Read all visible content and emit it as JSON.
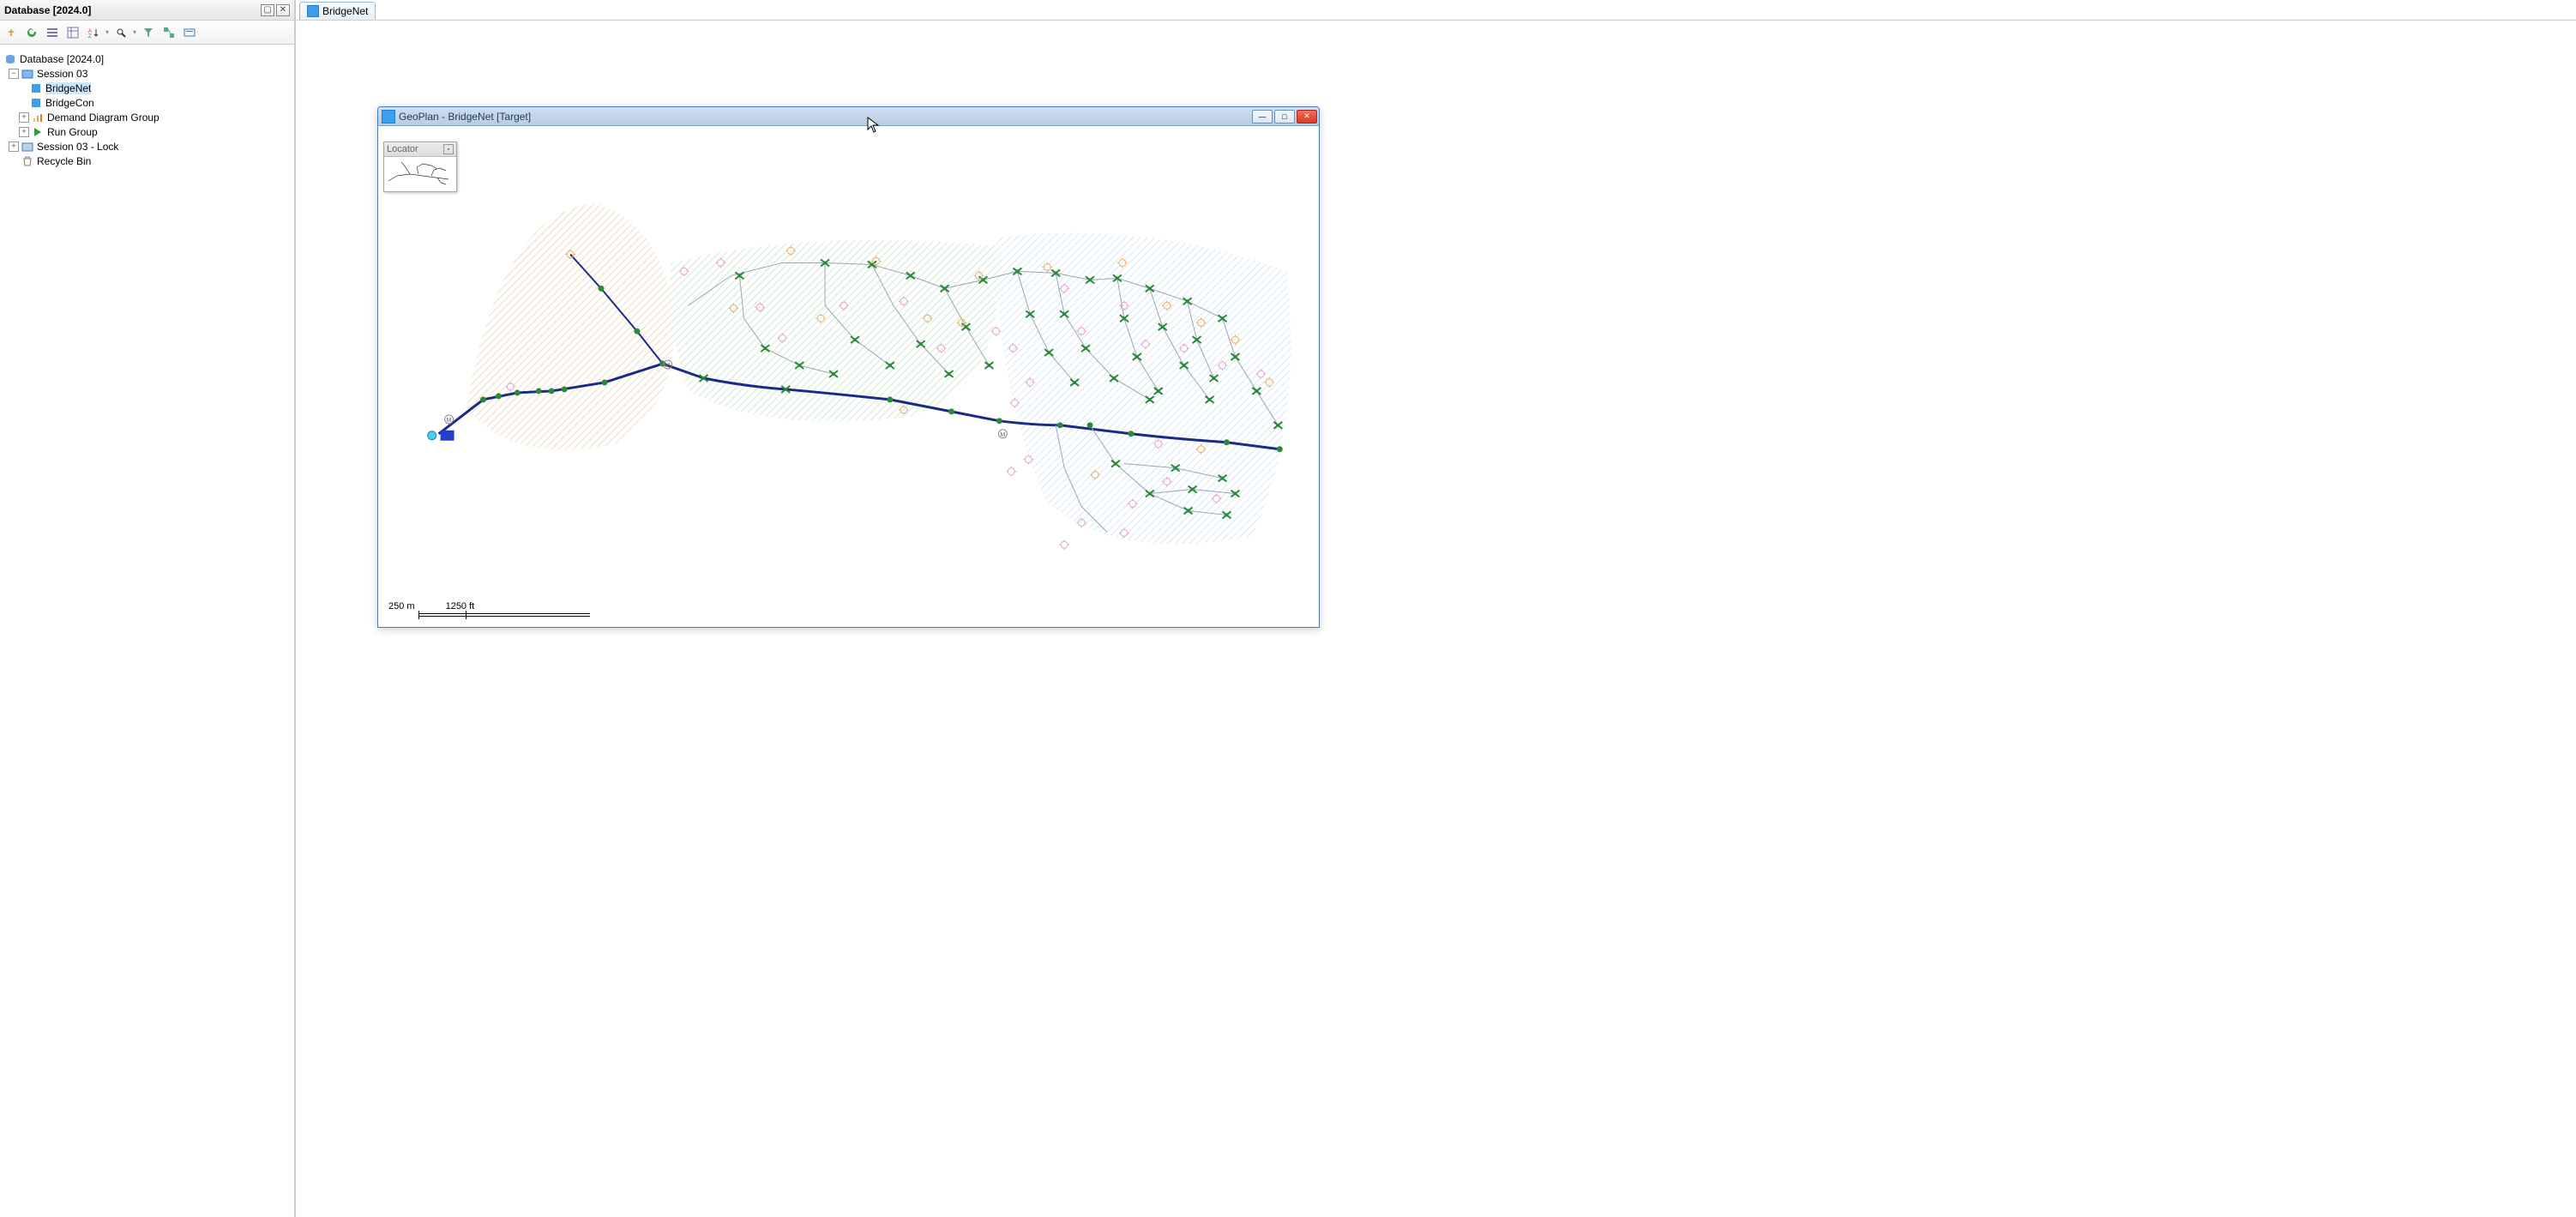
{
  "left": {
    "title": "Database [2024.0]",
    "toolbar": [
      {
        "name": "arrow-up-icon",
        "title": "Up"
      },
      {
        "name": "refresh-icon",
        "title": "Refresh"
      },
      {
        "name": "grid-icon",
        "title": "List"
      },
      {
        "name": "table-icon",
        "title": "Table"
      },
      {
        "name": "sort-az-icon",
        "title": "Sort"
      },
      {
        "name": "find-icon",
        "title": "Find"
      },
      {
        "name": "filter-icon",
        "title": "Filter"
      },
      {
        "name": "layout-icon",
        "title": "Layout"
      },
      {
        "name": "open-icon",
        "title": "Open"
      }
    ]
  },
  "tree": {
    "root": "Database [2024.0]",
    "session": "Session 03",
    "items": [
      {
        "label": "BridgeNet",
        "selected": true,
        "icon": "net"
      },
      {
        "label": "BridgeCon",
        "icon": "net"
      },
      {
        "label": "Demand Diagram Group",
        "icon": "chart",
        "expandable": true
      },
      {
        "label": "Run Group",
        "icon": "run",
        "expandable": true
      }
    ],
    "sessionLock": "Session 03 - Lock",
    "recycle": "Recycle Bin"
  },
  "rightTab": {
    "label": "BridgeNet"
  },
  "child": {
    "title": "GeoPlan - BridgeNet [Target]",
    "locator": "Locator",
    "scale_m": "250 m",
    "scale_ft": "1250 ft"
  }
}
